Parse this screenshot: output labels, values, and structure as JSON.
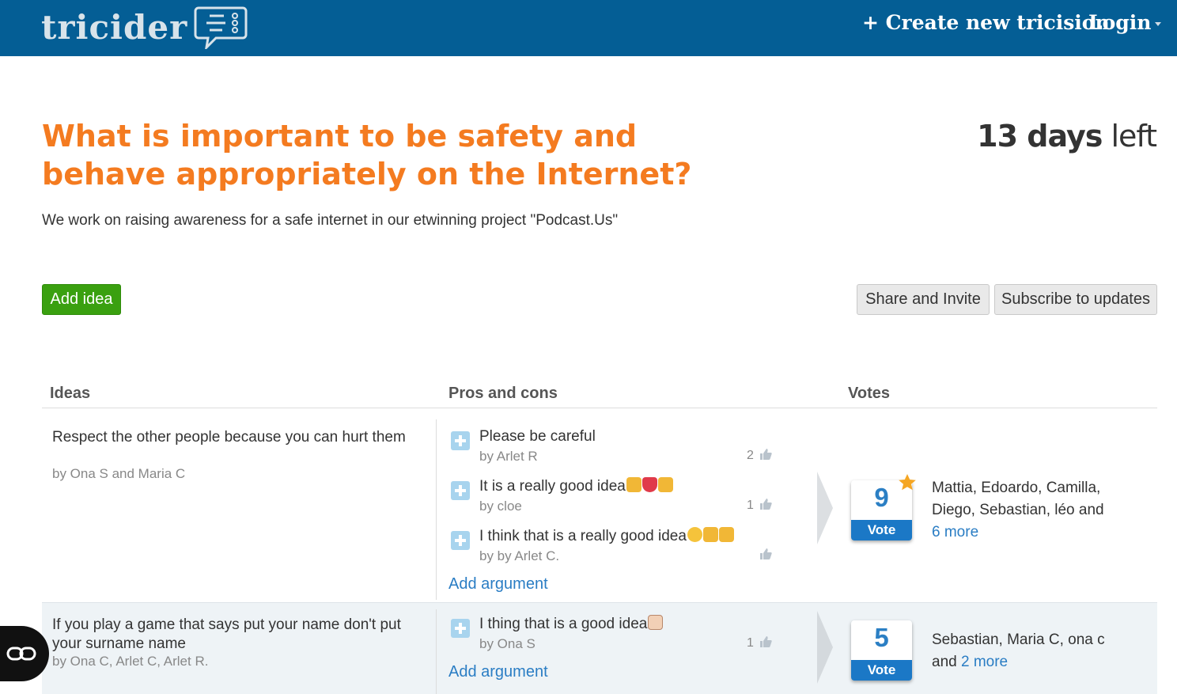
{
  "header": {
    "logo": "tricider",
    "create_label": "+ Create new tricision",
    "login_label": "Login"
  },
  "question": {
    "title": "What is important to be safety and behave appropriately on the Internet?",
    "days_number": "13 days",
    "days_suffix": "left",
    "description": "We work on raising awareness for a safe internet in our etwinning project \"Podcast.Us\""
  },
  "buttons": {
    "add_idea": "Add idea",
    "share": "Share and Invite",
    "subscribe": "Subscribe to updates"
  },
  "columns": {
    "ideas": "Ideas",
    "pros_cons": "Pros and cons",
    "votes": "Votes"
  },
  "ideas": [
    {
      "text": "Respect the other people because you can hurt them",
      "by": "by Ona S and Maria C",
      "arguments": [
        {
          "text": "Please be careful",
          "by": "by Arlet R",
          "likes": "2"
        },
        {
          "text": "It is a really good idea",
          "by": "by cloe",
          "likes": "1"
        },
        {
          "text": "I think that is a really good idea",
          "by": "by by Arlet C.",
          "likes": ""
        }
      ],
      "add_argument": "Add argument",
      "votes": "9",
      "vote_label": "Vote",
      "voters": "Mattia, Edoardo, Camilla, Diego, Sebastian, léo and",
      "more": "6 more"
    },
    {
      "text": "If you play a game that says put your name don't put your surname name",
      "by": "by Ona C, Arlet C, Arlet R.",
      "arguments": [
        {
          "text": "I thing that is a good idea",
          "by": "by Ona S",
          "likes": "1"
        }
      ],
      "add_argument": "Add argument",
      "votes": "5",
      "vote_label": "Vote",
      "voters": "Sebastian, Maria C, ona c and",
      "more": "2 more"
    }
  ],
  "colors": {
    "header_bg": "#045e95",
    "title": "#f47b20",
    "add_idea_green": "#3aa010",
    "link_blue": "#2a7dc4"
  }
}
